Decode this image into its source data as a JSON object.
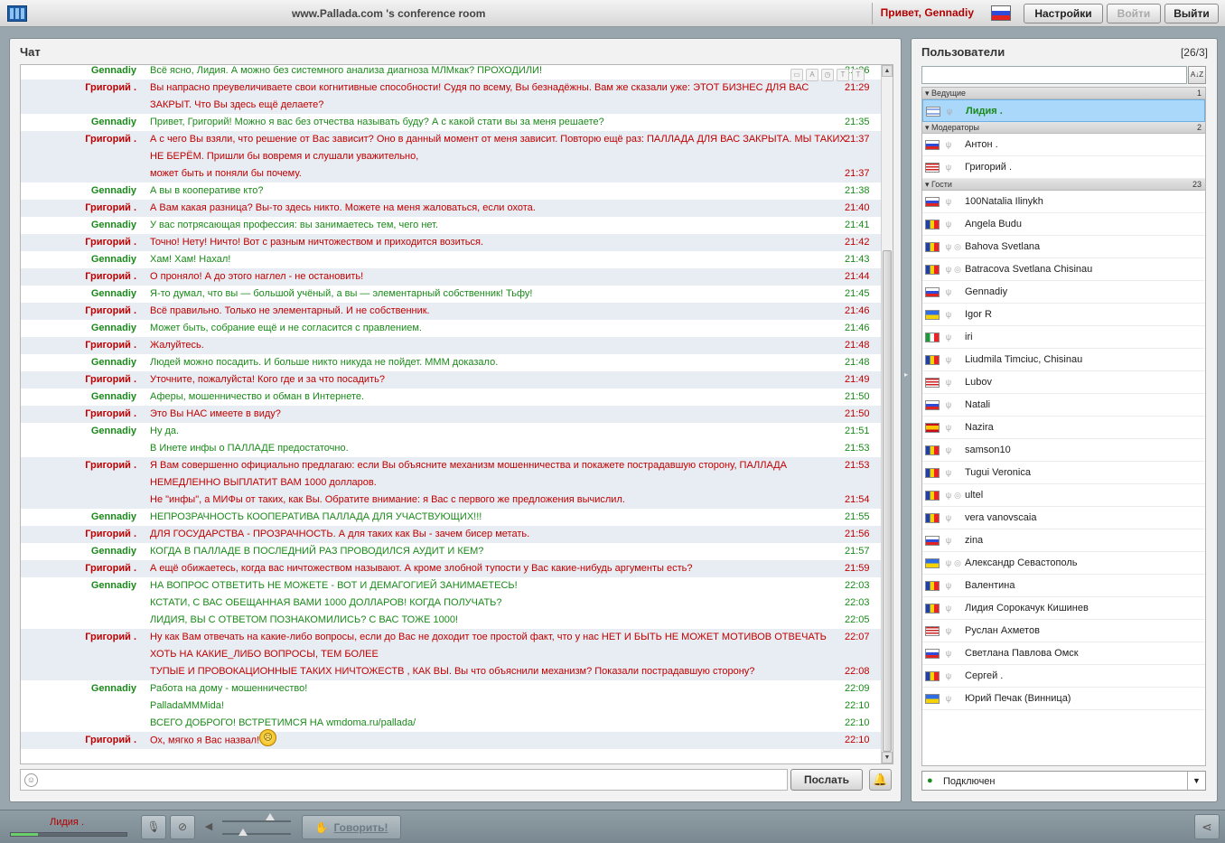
{
  "app": {
    "room_title": "www.Pallada.com 's conference room",
    "greeting": "Привет, Gennadiy",
    "buttons": {
      "settings": "Настройки",
      "login": "Войти",
      "logout": "Выйти"
    }
  },
  "chat": {
    "title": "Чат",
    "messages": [
      {
        "nick": "Gennadiy",
        "color": "g",
        "text": "Всё ясно, Лидия. А можно без системного анализа диагноза МЛМкак? ПРОХОДИЛИ!",
        "time": "21:26"
      },
      {
        "nick": "Григорий .",
        "color": "r",
        "text": "Вы напрасно преувеличиваете свои когнитивные способности! Судя по всему, Вы безнадёжны. Вам же сказали уже: ЭТОТ БИЗНЕС ДЛЯ ВАС",
        "time": "21:29"
      },
      {
        "nick": "",
        "color": "r",
        "text": "ЗАКРЫТ. Что Вы здесь ещё делаете?",
        "time": ""
      },
      {
        "nick": "Gennadiy",
        "color": "g",
        "text": "Привет, Григорий! Можно я вас без отчества называть буду? А с какой стати вы за меня решаете?",
        "time": "21:35"
      },
      {
        "nick": "Григорий .",
        "color": "r",
        "text": "А с чего Вы взяли, что решение от Вас зависит? Оно в данный момент от меня зависит. Повторю ещё раз: ПАЛЛАДА ДЛЯ ВАС ЗАКРЫТА. МЫ ТАКИХ",
        "time": "21:37"
      },
      {
        "nick": "",
        "color": "r",
        "text": "НЕ БЕРЁМ. Пришли бы вовремя и слушали уважительно,",
        "time": ""
      },
      {
        "nick": "",
        "color": "r",
        "text": "может быть и поняли бы почему.",
        "time": "21:37"
      },
      {
        "nick": "Gennadiy",
        "color": "g",
        "text": "А вы в кооперативе кто?",
        "time": "21:38"
      },
      {
        "nick": "Григорий .",
        "color": "r",
        "text": "А Вам какая разница? Вы-то здесь никто. Можете на меня жаловаться, если охота.",
        "time": "21:40"
      },
      {
        "nick": "Gennadiy",
        "color": "g",
        "text": "У вас потрясающая профессия: вы занимаетесь тем, чего нет.",
        "time": "21:41"
      },
      {
        "nick": "Григорий .",
        "color": "r",
        "text": "Точно! Нету! Ничто! Вот с разным ничтожеством и приходится возиться.",
        "time": "21:42"
      },
      {
        "nick": "Gennadiy",
        "color": "g",
        "text": "Хам! Хам! Нахал!",
        "time": "21:43"
      },
      {
        "nick": "Григорий .",
        "color": "r",
        "text": "О проняло! А до этого наглел - не остановить!",
        "time": "21:44"
      },
      {
        "nick": "Gennadiy",
        "color": "g",
        "text": "Я-то думал, что вы — большой учёный, а вы — элементарный собственник! Тьфу!",
        "time": "21:45"
      },
      {
        "nick": "Григорий .",
        "color": "r",
        "text": "Всё правильно. Только не элементарный. И не собственник.",
        "time": "21:46"
      },
      {
        "nick": "Gennadiy",
        "color": "g",
        "text": "Может быть, собрание ещё и не согласится с правлением.",
        "time": "21:46"
      },
      {
        "nick": "Григорий .",
        "color": "r",
        "text": "Жалуйтесь.",
        "time": "21:48"
      },
      {
        "nick": "Gennadiy",
        "color": "g",
        "text": "Людей можно посадить. И больше никто никуда не пойдет. МММ доказало.",
        "time": "21:48"
      },
      {
        "nick": "Григорий .",
        "color": "r",
        "text": "Уточните, пожалуйста! Кого где и за что посадить?",
        "time": "21:49"
      },
      {
        "nick": "Gennadiy",
        "color": "g",
        "text": "Аферы, мошенничество и обман в Интернете.",
        "time": "21:50"
      },
      {
        "nick": "Григорий .",
        "color": "r",
        "text": "Это Вы НАС имеете в виду?",
        "time": "21:50"
      },
      {
        "nick": "Gennadiy",
        "color": "g",
        "text": "Ну да.",
        "time": "21:51"
      },
      {
        "nick": "",
        "color": "g",
        "text": "В Инете инфы о ПАЛЛАДЕ предостаточно.",
        "time": "21:53"
      },
      {
        "nick": "Григорий .",
        "color": "r",
        "text": "Я Вам совершенно официально предлагаю: если Вы объясните механизм мошенничества и покажете пострадавшую сторону, ПАЛЛАДА",
        "time": "21:53"
      },
      {
        "nick": "",
        "color": "r",
        "text": "НЕМЕДЛЕННО ВЫПЛАТИТ ВАМ 1000 долларов.",
        "time": ""
      },
      {
        "nick": "",
        "color": "r",
        "text": "Не \"инфы\", а МИФы от таких, как Вы. Обратите внимание: я Вас с первого же предложения вычислил.",
        "time": "21:54"
      },
      {
        "nick": "Gennadiy",
        "color": "g",
        "text": "НЕПРОЗРАЧНОСТЬ КООПЕРАТИВА ПАЛЛАДА ДЛЯ УЧАСТВУЮЩИХ!!!",
        "time": "21:55"
      },
      {
        "nick": "Григорий .",
        "color": "r",
        "text": "ДЛЯ ГОСУДАРСТВА - ПРОЗРАЧНОСТЬ. А для таких как Вы - зачем бисер метать.",
        "time": "21:56"
      },
      {
        "nick": "Gennadiy",
        "color": "g",
        "text": "КОГДА В ПАЛЛАДЕ В ПОСЛЕДНИЙ РАЗ ПРОВОДИЛСЯ АУДИТ И КЕМ?",
        "time": "21:57"
      },
      {
        "nick": "Григорий .",
        "color": "r",
        "text": "А ещё обижаетесь, когда вас ничтожеством называют. А кроме злобной тупости у Вас какие-нибудь аргументы есть?",
        "time": "21:59"
      },
      {
        "nick": "Gennadiy",
        "color": "g",
        "text": "НА ВОПРОС ОТВЕТИТЬ НЕ МОЖЕТЕ - ВОТ И ДЕМАГОГИЕЙ ЗАНИМАЕТЕСЬ!",
        "time": "22:03"
      },
      {
        "nick": "",
        "color": "g",
        "text": "КСТАТИ, С ВАС ОБЕЩАННАЯ ВАМИ 1000 ДОЛЛАРОВ! КОГДА ПОЛУЧАТЬ?",
        "time": "22:03"
      },
      {
        "nick": "",
        "color": "g",
        "text": "ЛИДИЯ, ВЫ С ОТВЕТОМ ПОЗНАКОМИЛИСЬ? С ВАС ТОЖЕ 1000!",
        "time": "22:05"
      },
      {
        "nick": "Григорий .",
        "color": "r",
        "text": "Ну как Вам отвечать на какие-либо вопросы, если до Вас не доходит тое простой факт, что у нас НЕТ И БЫТЬ НЕ МОЖЕТ МОТИВОВ ОТВЕЧАТЬ",
        "time": "22:07"
      },
      {
        "nick": "",
        "color": "r",
        "text": "ХОТЬ НА КАКИЕ_ЛИБО ВОПРОСЫ, ТЕМ БОЛЕЕ",
        "time": ""
      },
      {
        "nick": "",
        "color": "r",
        "text": "ТУПЫЕ И ПРОВОКАЦИОННЫЕ ТАКИХ НИЧТОЖЕСТВ , КАК ВЫ. Вы что объяснили механизм? Показали пострадавшую сторону?",
        "time": "22:08"
      },
      {
        "nick": "Gennadiy",
        "color": "g",
        "text": "Работа на дому - мошенничество!",
        "time": "22:09"
      },
      {
        "nick": "",
        "color": "g",
        "text": "PalladaMMMida!",
        "time": "22:10"
      },
      {
        "nick": "",
        "color": "g",
        "text": "ВСЕГО ДОБРОГО! ВСТРЕТИМСЯ НА  wmdoma.ru/pallada/",
        "time": "22:10"
      },
      {
        "nick": "Григорий .",
        "color": "r",
        "text": "Ох, мягко я Вас назвал!",
        "time": "22:10",
        "smiley": true
      }
    ],
    "send_label": "Послать"
  },
  "users": {
    "title": "Пользователи",
    "count": "[26/3]",
    "groups": [
      {
        "name": "Ведущие",
        "count": "1",
        "users": [
          {
            "name": "Лидия .",
            "flag": "f-il",
            "selected": true
          }
        ]
      },
      {
        "name": "Модераторы",
        "count": "2",
        "users": [
          {
            "name": "Антон .",
            "flag": "f-ru"
          },
          {
            "name": "Григорий .",
            "flag": "f-us"
          }
        ]
      },
      {
        "name": "Гости",
        "count": "23",
        "users": [
          {
            "name": "100Natalia Ilinykh",
            "flag": "f-ru"
          },
          {
            "name": "Angela Budu",
            "flag": "f-md"
          },
          {
            "name": "Bahova Svetlana",
            "flag": "f-md",
            "cam": true
          },
          {
            "name": "Batracova Svetlana Chisinau",
            "flag": "f-md",
            "cam": true
          },
          {
            "name": "Gennadiy",
            "flag": "f-ru"
          },
          {
            "name": "Igor R",
            "flag": "f-ua"
          },
          {
            "name": "iri",
            "flag": "f-it"
          },
          {
            "name": "Liudmila Timciuc, Chisinau",
            "flag": "f-md"
          },
          {
            "name": "Lubov",
            "flag": "f-us"
          },
          {
            "name": "Natali",
            "flag": "f-ru"
          },
          {
            "name": "Nazira",
            "flag": "f-es"
          },
          {
            "name": "samson10",
            "flag": "f-md"
          },
          {
            "name": "Tugui Veronica",
            "flag": "f-md"
          },
          {
            "name": "ultel",
            "flag": "f-md",
            "cam": true
          },
          {
            "name": "vera vanovscaia",
            "flag": "f-md"
          },
          {
            "name": "zina",
            "flag": "f-ru"
          },
          {
            "name": "Александр Севастополь",
            "flag": "f-ua",
            "cam": true
          },
          {
            "name": "Валентина",
            "flag": "f-md"
          },
          {
            "name": "Лидия Сорокачук Кишинев",
            "flag": "f-md"
          },
          {
            "name": "Руслан Ахметов",
            "flag": "f-us"
          },
          {
            "name": "Светлана Павлова Омск",
            "flag": "f-ru"
          },
          {
            "name": "Сергей .",
            "flag": "f-md"
          },
          {
            "name": "Юрий Печак (Винница)",
            "flag": "f-ua"
          }
        ]
      }
    ],
    "status": "Подключен"
  },
  "bottom": {
    "my_name": "Лидия .",
    "speak_label": "Говорить!"
  },
  "icons": {
    "mic": "microphone-icon",
    "camera": "camera-icon",
    "share": "share-icon",
    "bell": "bell-icon",
    "smiley": "smiley-icon"
  },
  "colors": {
    "own_text": "#1a8a1a",
    "other_text": "#c00000",
    "alt_row": "#e8edf3",
    "selected_user": "#a9d8fb"
  }
}
